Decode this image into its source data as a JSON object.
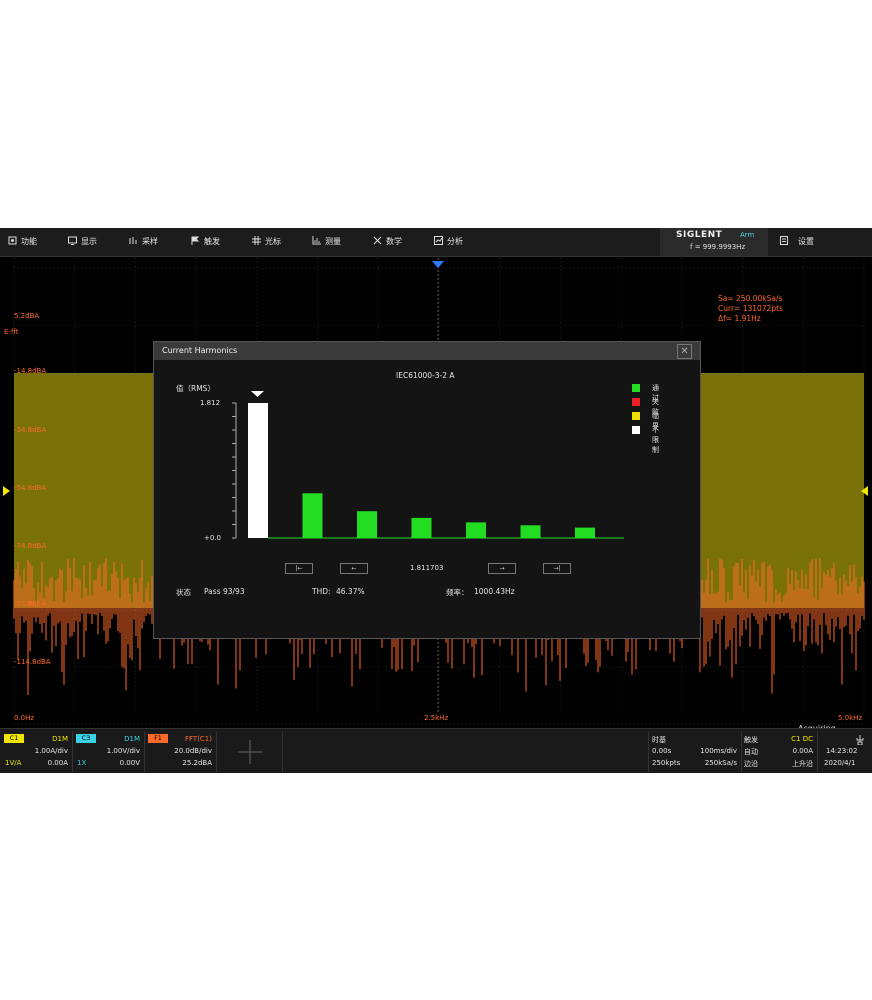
{
  "menu": [
    {
      "label": "功能",
      "icon": "function-icon"
    },
    {
      "label": "显示",
      "icon": "display-icon"
    },
    {
      "label": "采样",
      "icon": "acquire-icon"
    },
    {
      "label": "触发",
      "icon": "trigger-flag-icon"
    },
    {
      "label": "光标",
      "icon": "cursor-icon"
    },
    {
      "label": "测量",
      "icon": "measure-icon"
    },
    {
      "label": "数学",
      "icon": "math-icon"
    },
    {
      "label": "分析",
      "icon": "analysis-icon"
    }
  ],
  "brand": {
    "name": "SIGLENT",
    "arm": "Arm",
    "freq": "f = 999.9993Hz"
  },
  "settings_label": "设置",
  "info": {
    "line1": "Sa= 250.00kSa/s",
    "line2": "Curr= 131072pts",
    "line3": "Δf= 1.91Hz"
  },
  "axis": {
    "top": "5.2dBA",
    "mode": "E-fft",
    "y1": "-14.8dBA",
    "y2": "-34.8dBA",
    "y3": "-54.8dBA",
    "y4": "-74.8dBA",
    "y5": "-94.8dBA",
    "y6": "-114.8dBA",
    "x_left": "0.0Hz",
    "x_mid": "2.5kHz",
    "x_right": "5.0kHz"
  },
  "acquiring": "Acquiring",
  "dialog": {
    "title": "Current Harmonics",
    "standard": "IEC61000-3-2 A",
    "y_label": "值（RMS）",
    "y_max": "1.812",
    "y_min": "+0.0",
    "current_value": "1.811703",
    "status_label": "状态",
    "status_value": "Pass 93/93",
    "thd_label": "THD:",
    "thd_value": "46.37%",
    "freq_label": "频率：",
    "freq_value": "1000.43Hz",
    "nav": [
      "|←",
      "←",
      "→",
      "→|"
    ],
    "legend": [
      {
        "label": "通过",
        "color": "#22dd22"
      },
      {
        "label": "失败",
        "color": "#ee2222"
      },
      {
        "label": "临界",
        "color": "#eedd00"
      },
      {
        "label": "不限制",
        "color": "#ffffff"
      }
    ]
  },
  "chart_data": {
    "type": "bar",
    "ylim": [
      0,
      1.812
    ],
    "values": [
      1.812,
      0.6,
      0.36,
      0.27,
      0.21,
      0.17,
      0.14
    ],
    "status": [
      "unlimited",
      "pass",
      "pass",
      "pass",
      "pass",
      "pass",
      "pass"
    ]
  },
  "channels": [
    {
      "tag": "C1",
      "tag_color": "#f2e600",
      "coupling": "D1M",
      "div": "1.00A/div",
      "offset": "0.00A",
      "probe": "1V/A"
    },
    {
      "tag": "C3",
      "tag_color": "#3ad0e6",
      "coupling": "D1M",
      "div": "1.00V/div",
      "offset": "0.00V",
      "probe": "1X"
    },
    {
      "tag": "F1",
      "tag_color": "#ff6a2a",
      "coupling": "FFT(C1)",
      "div": "20.0dB/div",
      "offset": "25.2dBA",
      "probe": ""
    }
  ],
  "timebase": {
    "label": "时基",
    "delay": "0.00s",
    "scale": "100ms/div",
    "points": "250kpts",
    "rate": "250kSa/s"
  },
  "trigger": {
    "label": "触发",
    "source": "C1 DC",
    "mode": "自动",
    "level": "0.00A",
    "type": "边沿",
    "slope": "上升沿"
  },
  "clock": {
    "time": "14:23:02",
    "date": "2020/4/1"
  }
}
